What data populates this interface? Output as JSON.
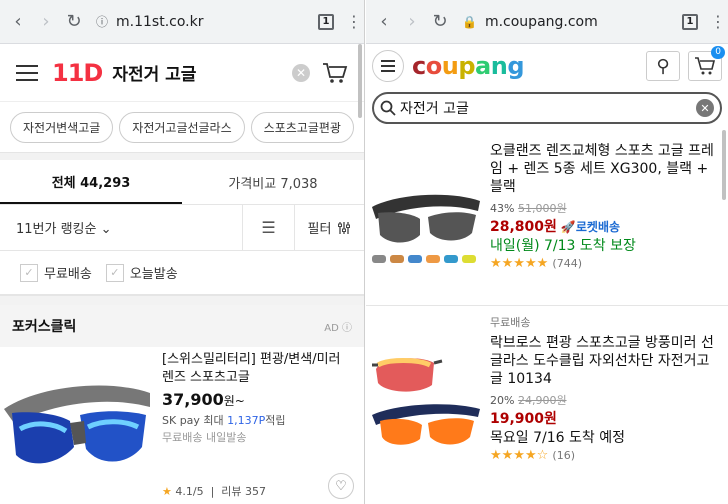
{
  "left_browser": {
    "url": "m.11st.co.kr",
    "tab_count": "1"
  },
  "right_browser": {
    "url": "m.coupang.com",
    "tab_count": "1"
  },
  "st11": {
    "logo": "11D",
    "query": "자전거 고글",
    "chips": [
      "자전거변색고글",
      "자전거고글선글라스",
      "스포츠고글편광"
    ],
    "tabs": [
      {
        "label": "전체 44,293"
      },
      {
        "label": "가격비교 7,038"
      }
    ],
    "sort": "11번가 랭킹순",
    "filter": "필터",
    "checks": [
      "무료배송",
      "오늘발송"
    ],
    "focus_click": {
      "title": "포커스클릭",
      "ad": "AD"
    },
    "product": {
      "name": "[스위스밀리터리] 편광/변색/미러 렌즈 스포츠고글",
      "price": "37,900",
      "price_unit": "원~",
      "sk_pay_prefix": "SK pay 최대",
      "sk_pay_points": "1,137P",
      "sk_pay_suffix": "적립",
      "shipping": "무료배송 내일발송",
      "rating": "4.1",
      "rating_max": "/5",
      "review_label": "리뷰",
      "reviews": "357"
    }
  },
  "coupang": {
    "logo_letters": [
      "c",
      "o",
      "u",
      "p",
      "a",
      "n",
      "g"
    ],
    "logo_colors": [
      "#a5252b",
      "#e74c3c",
      "#f39c12",
      "#f1c40f",
      "#2ecc71",
      "#1abc9c",
      "#3498db"
    ],
    "query": "자전거 고글",
    "cart_badge": "0",
    "products": [
      {
        "free": "",
        "name": "오클랜즈 렌즈교체형 스포츠 고글 프레임 + 렌즈 5종 세트 XG300, 블랙 + 블랙",
        "discount": "43%",
        "orig": "51,000원",
        "price": "28,800원",
        "rocket": "로켓배송",
        "delivery": "내일(월) 7/13 도착 보장",
        "delivery_green": true,
        "stars": "★★★★★",
        "reviews": "(744)"
      },
      {
        "free": "무료배송",
        "name": "락브로스 편광 스포츠고글 방풍미러 선글라스 도수클립 자외선차단 자전거고글 10134",
        "discount": "20%",
        "orig": "24,900원",
        "price": "19,900원",
        "rocket": "",
        "delivery": "목요일 7/16 도착 예정",
        "delivery_green": false,
        "stars": "★★★★☆",
        "reviews": "(16)"
      }
    ]
  }
}
